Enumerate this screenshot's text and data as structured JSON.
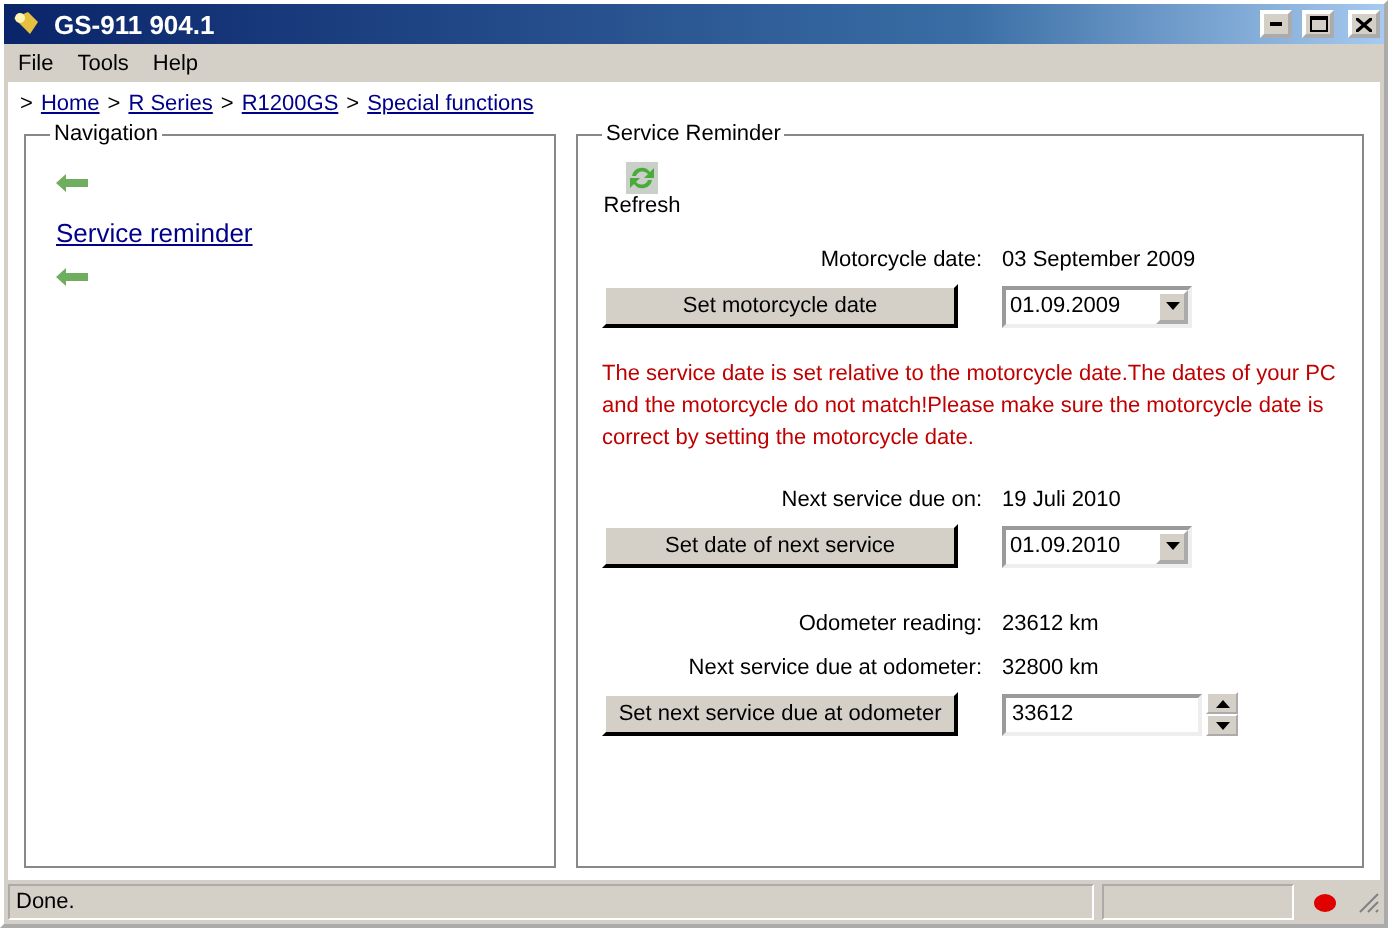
{
  "window": {
    "title": "GS-911 904.1"
  },
  "menu": [
    "File",
    "Tools",
    "Help"
  ],
  "breadcrumb": [
    {
      "separator": ">",
      "label": "Home"
    },
    {
      "separator": ">",
      "label": "R Series"
    },
    {
      "separator": ">",
      "label": "R1200GS"
    },
    {
      "separator": ">",
      "label": "Special functions"
    }
  ],
  "navigation": {
    "title": "Navigation",
    "items": [
      {
        "kind": "back"
      },
      {
        "kind": "link",
        "label": "Service reminder"
      },
      {
        "kind": "back"
      }
    ]
  },
  "service_reminder": {
    "title": "Service Reminder",
    "refresh": "Refresh",
    "rows": [
      {
        "kind": "info",
        "label": "Motorcycle date:",
        "value": "03 September 2009"
      },
      {
        "kind": "date",
        "button": "Set motorcycle date",
        "value": "01.09.2009"
      },
      {
        "kind": "message",
        "text": "The service date is set relative to the motorcycle date.The dates of your PC and the motorcycle do not match!Please make sure the motorcycle date is correct by setting the motorcycle date."
      },
      {
        "kind": "info",
        "label": "Next service due on:",
        "value": "19 Juli 2010"
      },
      {
        "kind": "date",
        "button": "Set date of next service",
        "value": "01.09.2010"
      },
      {
        "kind": "gap"
      },
      {
        "kind": "info",
        "label": "Odometer reading:",
        "value": "23612 km"
      },
      {
        "kind": "info",
        "label": "Next service due at odometer:",
        "value": "32800 km"
      },
      {
        "kind": "number",
        "button": "Set next service due at odometer",
        "value": "33612"
      }
    ]
  },
  "status_bar": {
    "text": "Done.",
    "connected": false
  }
}
